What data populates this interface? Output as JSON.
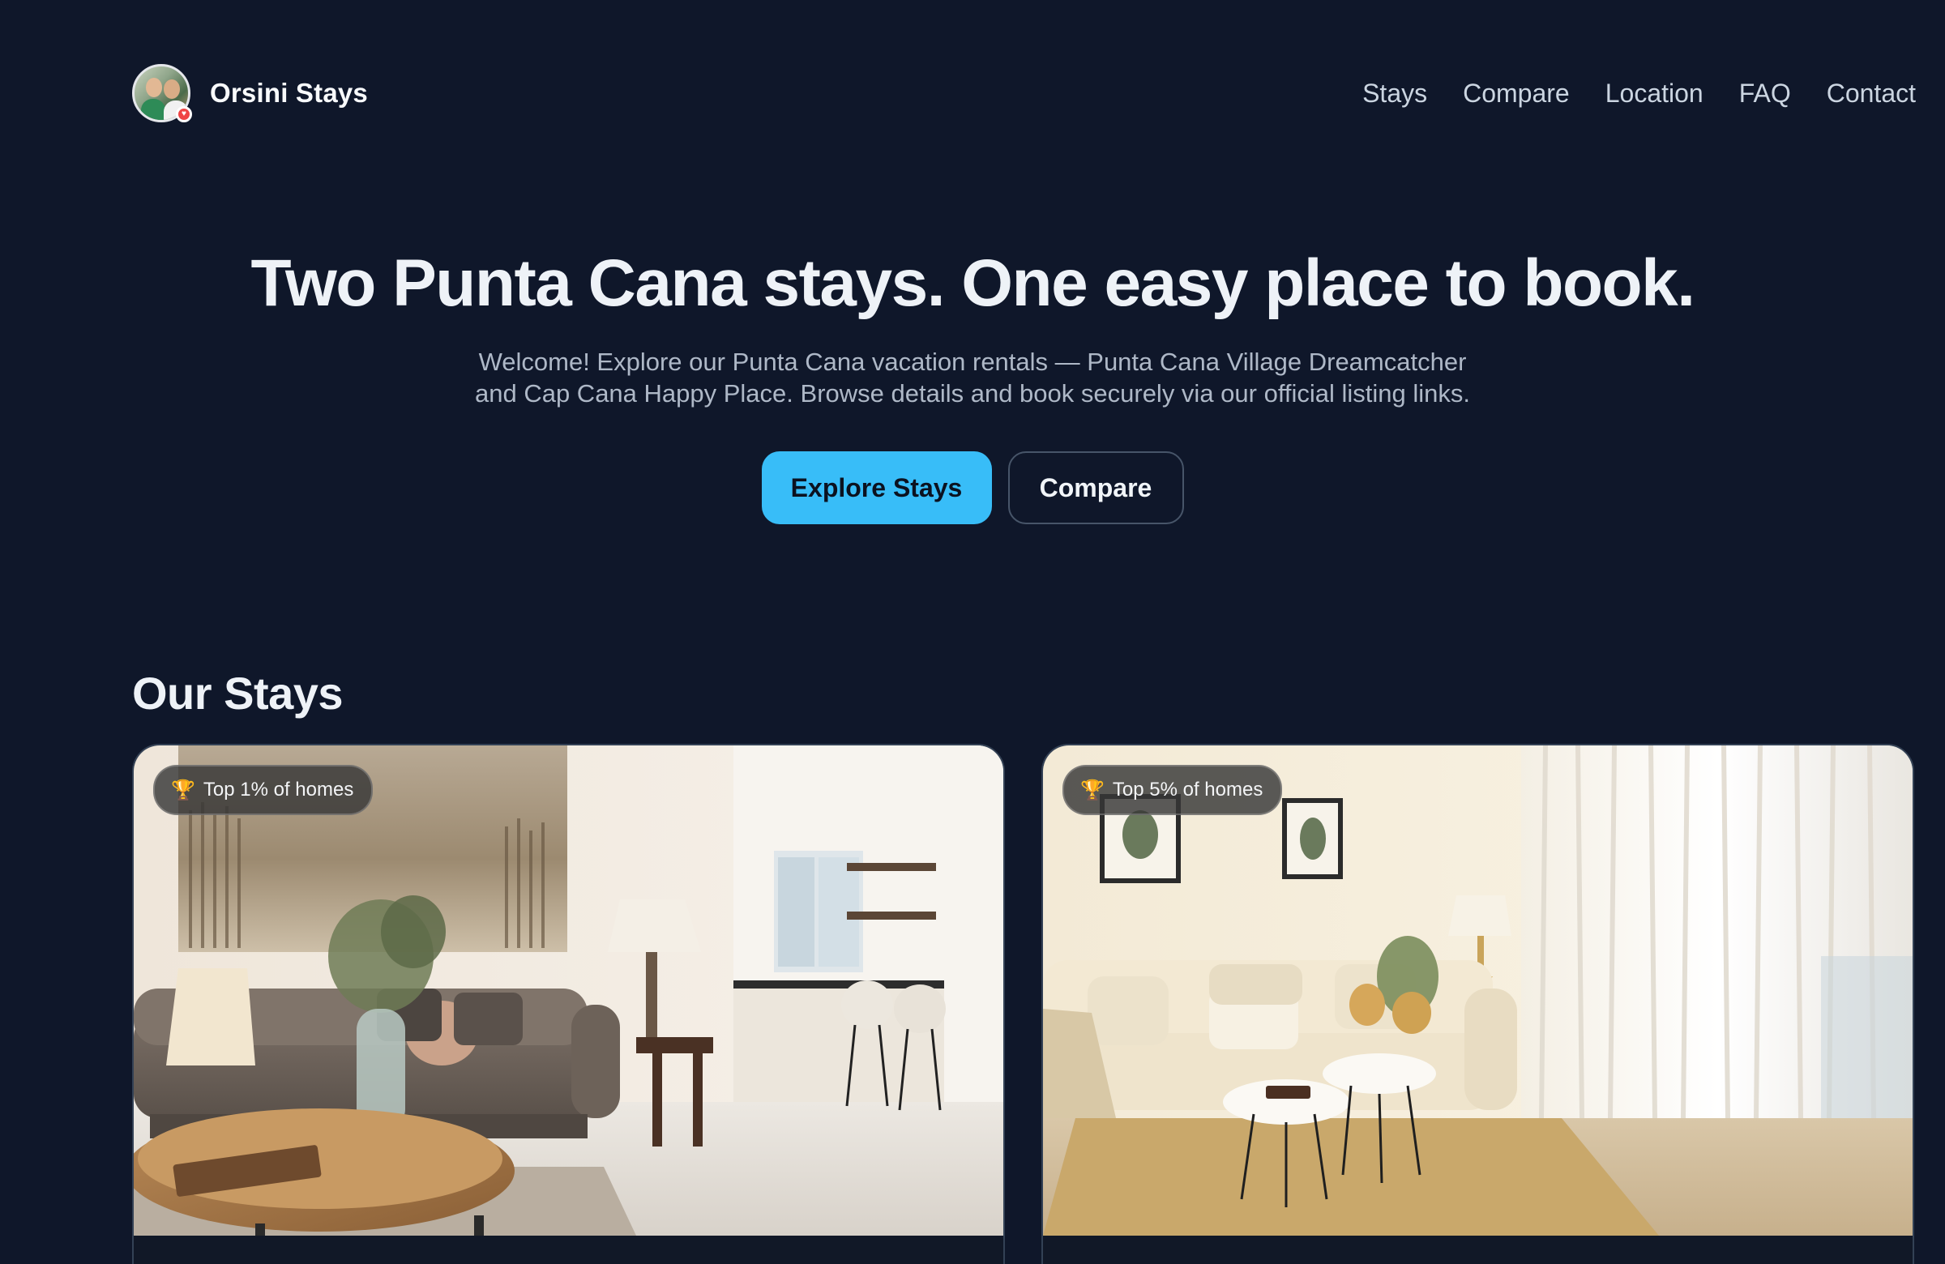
{
  "header": {
    "brand_name": "Orsini Stays",
    "nav": [
      "Stays",
      "Compare",
      "Location",
      "FAQ",
      "Contact"
    ]
  },
  "hero": {
    "title": "Two Punta Cana stays. One easy place to book.",
    "subtitle_line1": "Welcome! Explore our Punta Cana vacation rentals — Punta Cana Village Dreamcatcher",
    "subtitle_line2": "and Cap Cana Happy Place. Browse details and book securely via our official listing links.",
    "primary_button": "Explore Stays",
    "secondary_button": "Compare"
  },
  "stays": {
    "section_title": "Our Stays",
    "cards": [
      {
        "badge": "Top 1% of homes",
        "badge_icon": "trophy-icon"
      },
      {
        "badge": "Top 5% of homes",
        "badge_icon": "trophy-icon"
      }
    ]
  },
  "colors": {
    "background": "#0f172a",
    "accent": "#38bdf8"
  }
}
